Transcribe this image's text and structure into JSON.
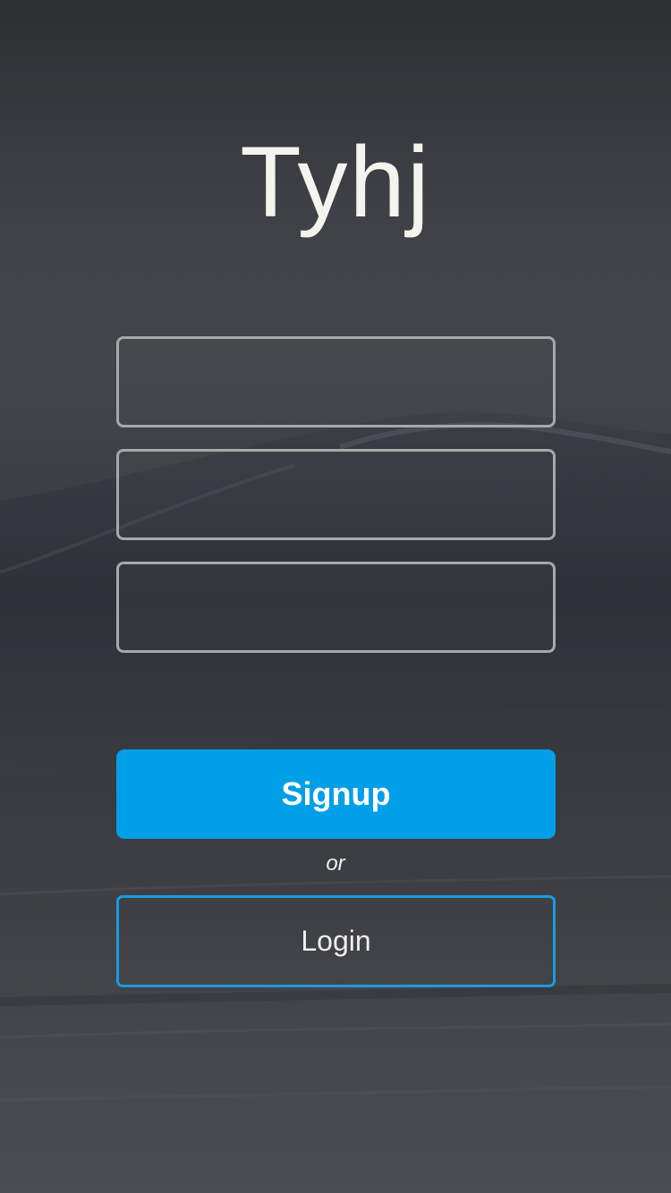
{
  "brand": {
    "title": "Tyhj"
  },
  "form": {
    "fields": [
      {
        "value": "",
        "placeholder": ""
      },
      {
        "value": "",
        "placeholder": ""
      },
      {
        "value": "",
        "placeholder": ""
      }
    ]
  },
  "actions": {
    "signup_label": "Signup",
    "separator": "or",
    "login_label": "Login"
  },
  "colors": {
    "primary": "#009fe8",
    "login_border": "#1a9be0",
    "field_border": "#a7a8aa",
    "title": "#f4f4ee"
  }
}
